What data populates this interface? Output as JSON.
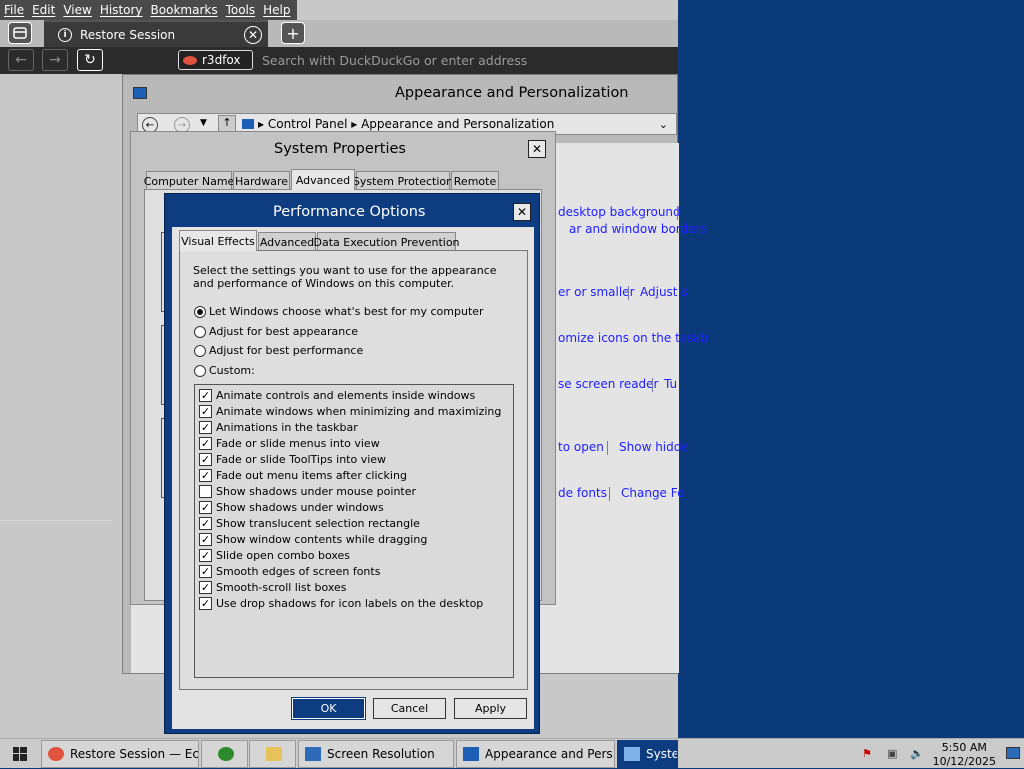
{
  "browser": {
    "menu": [
      "File",
      "Edit",
      "View",
      "History",
      "Bookmarks",
      "Tools",
      "Help"
    ],
    "tab_title": "Restore Session",
    "identity_label": "r3dfox",
    "address_placeholder": "Search with DuckDuckGo or enter address"
  },
  "control_panel": {
    "title": "Appearance and Personalization",
    "breadcrumb": [
      "Control Panel",
      "Appearance and Personalization"
    ],
    "links": [
      "desktop background",
      "ar and window borders",
      "er or smaller",
      "Adjust s",
      "omize icons on the taskb",
      "se screen reader",
      "Tu",
      "to open",
      "Show hidde",
      "de fonts",
      "Change Fo"
    ]
  },
  "system_properties": {
    "title": "System Properties",
    "tabs": [
      "Computer Name",
      "Hardware",
      "Advanced",
      "System Protection",
      "Remote"
    ],
    "selected_tab": "Advanced"
  },
  "performance_options": {
    "title": "Performance Options",
    "tabs": [
      "Visual Effects",
      "Advanced",
      "Data Execution Prevention"
    ],
    "selected_tab": "Visual Effects",
    "description": "Select the settings you want to use for the appearance and performance of Windows on this computer.",
    "radios": [
      {
        "label": "Let Windows choose what's best for my computer",
        "selected": true
      },
      {
        "label": "Adjust for best appearance",
        "selected": false
      },
      {
        "label": "Adjust for best performance",
        "selected": false
      },
      {
        "label": "Custom:",
        "selected": false
      }
    ],
    "effects": [
      {
        "label": "Animate controls and elements inside windows",
        "checked": true
      },
      {
        "label": "Animate windows when minimizing and maximizing",
        "checked": true
      },
      {
        "label": "Animations in the taskbar",
        "checked": true
      },
      {
        "label": "Fade or slide menus into view",
        "checked": true
      },
      {
        "label": "Fade or slide ToolTips into view",
        "checked": true
      },
      {
        "label": "Fade out menu items after clicking",
        "checked": true
      },
      {
        "label": "Show shadows under mouse pointer",
        "checked": false
      },
      {
        "label": "Show shadows under windows",
        "checked": true
      },
      {
        "label": "Show translucent selection rectangle",
        "checked": true
      },
      {
        "label": "Show window contents while dragging",
        "checked": true
      },
      {
        "label": "Slide open combo boxes",
        "checked": true
      },
      {
        "label": "Smooth edges of screen fonts",
        "checked": true
      },
      {
        "label": "Smooth-scroll list boxes",
        "checked": true
      },
      {
        "label": "Use drop shadows for icon labels on the desktop",
        "checked": true
      }
    ],
    "buttons": {
      "ok": "OK",
      "cancel": "Cancel",
      "apply": "Apply"
    }
  },
  "taskbar": {
    "items": [
      {
        "label": "Restore Session — Ec...",
        "icon": "firefox-icon"
      },
      {
        "label": "",
        "icon": "globe-icon"
      },
      {
        "label": "",
        "icon": "folder-icon"
      },
      {
        "label": "Screen Resolution",
        "icon": "monitor-icon"
      },
      {
        "label": "Appearance and Pers...",
        "icon": "control-panel-icon"
      },
      {
        "label": "Syster",
        "icon": "system-icon"
      }
    ],
    "time": "5:50 AM",
    "date": "10/12/2025"
  },
  "colors": {
    "desktop": "#0b3a7a",
    "dialog_frame": "#0d3d80",
    "link": "#2020ff"
  }
}
